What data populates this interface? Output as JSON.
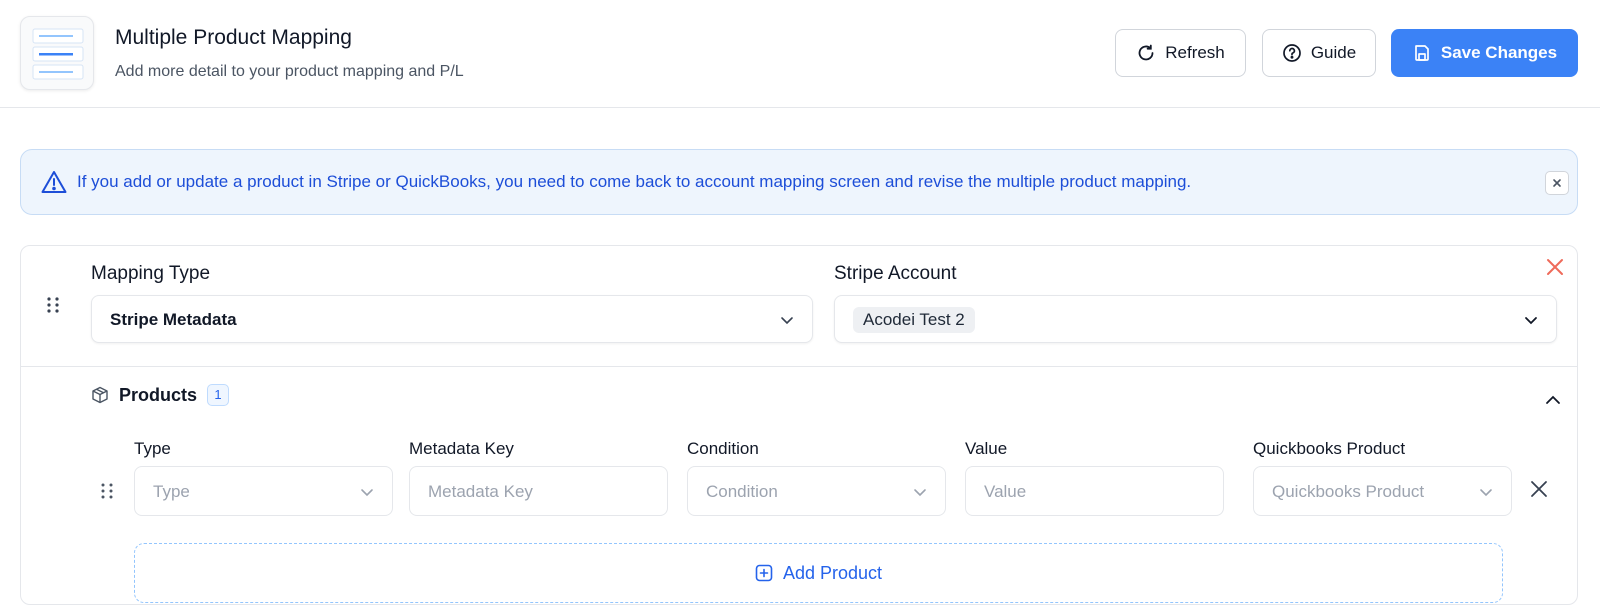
{
  "header": {
    "title": "Multiple Product Mapping",
    "subtitle": "Add more detail to your product mapping and P/L",
    "buttons": {
      "refresh": "Refresh",
      "guide": "Guide",
      "save": "Save Changes"
    }
  },
  "alert": {
    "text": "If you add or update a product in Stripe or QuickBooks, you need to come back to account mapping screen and revise the multiple product mapping."
  },
  "mapping": {
    "mapping_type_label": "Mapping Type",
    "mapping_type_value": "Stripe Metadata",
    "stripe_account_label": "Stripe Account",
    "stripe_account_value": "Acodei Test 2"
  },
  "products": {
    "title": "Products",
    "count": "1",
    "columns": [
      "Type",
      "Metadata Key",
      "Condition",
      "Value",
      "Quickbooks Product"
    ],
    "row": {
      "type_placeholder": "Type",
      "metadata_key_placeholder": "Metadata Key",
      "condition_placeholder": "Condition",
      "value_placeholder": "Value",
      "qb_product_placeholder": "Quickbooks Product"
    },
    "add_label": "Add Product"
  },
  "colors": {
    "accent": "#3b82f6",
    "alert_bg": "#eef5fd",
    "alert_text": "#1d4ed8",
    "danger": "#ef4444"
  },
  "icons": [
    "app-logo-icon",
    "refresh-icon",
    "help-circle-icon",
    "save-icon",
    "warning-triangle-icon",
    "close-icon",
    "drag-handle-icon",
    "chevron-down-icon",
    "chevron-up-icon",
    "package-icon",
    "plus-square-icon"
  ]
}
